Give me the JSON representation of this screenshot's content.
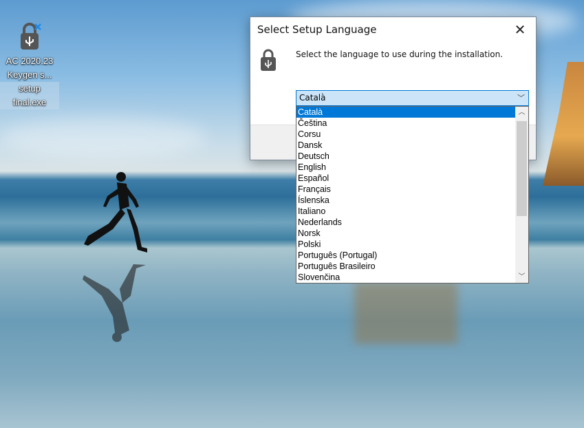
{
  "desktop_icon": {
    "line1": "AC 2020.23",
    "line2": "Keygen s...",
    "line3": "setup",
    "line4": "final.exe"
  },
  "dialog": {
    "title": "Select Setup Language",
    "prompt": "Select the language to use during the installation.",
    "close_glyph": "✕"
  },
  "combo": {
    "value": "Català"
  },
  "languages": [
    "Català",
    "Čeština",
    "Corsu",
    "Dansk",
    "Deutsch",
    "English",
    "Español",
    "Français",
    "Íslenska",
    "Italiano",
    "Nederlands",
    "Norsk",
    "Polski",
    "Português (Portugal)",
    "Português Brasileiro",
    "Slovenčina"
  ],
  "selected_index": 0
}
